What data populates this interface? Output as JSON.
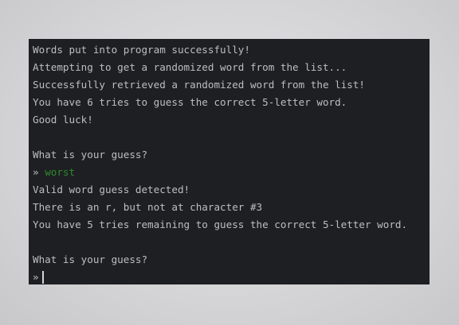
{
  "terminal": {
    "lines": [
      "Words put into program successfully!",
      "Attempting to get a randomized word from the list...",
      "Successfully retrieved a randomized word from the list!",
      "You have 6 tries to guess the correct 5-letter word.",
      "Good luck!",
      "",
      "What is your guess?"
    ],
    "prompt_symbol": "»",
    "user_input": "worst",
    "response_lines": [
      "Valid word guess detected!",
      "There is an r, but not at character #3",
      "You have 5 tries remaining to guess the correct 5-letter word.",
      "",
      "What is your guess?"
    ],
    "colors": {
      "background": "#1e1f22",
      "text": "#bcbec4",
      "user_input": "#2e8a2e"
    }
  }
}
